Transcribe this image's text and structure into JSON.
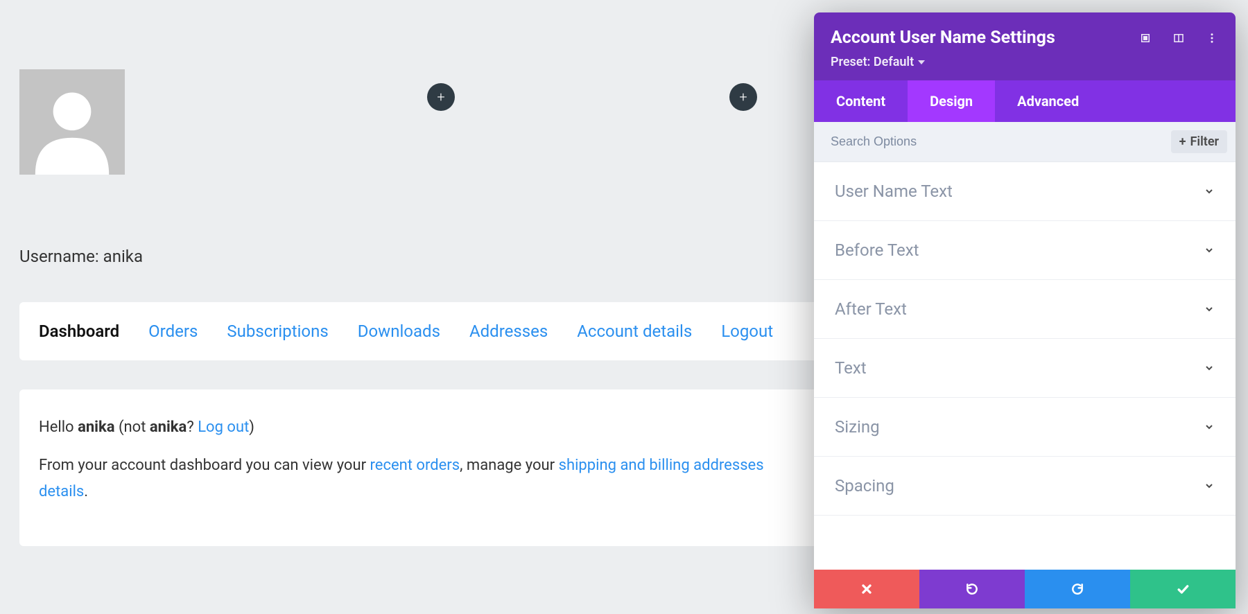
{
  "account": {
    "username_label": "Username:",
    "username": "anika"
  },
  "nav": {
    "items": [
      {
        "label": "Dashboard",
        "active": true
      },
      {
        "label": "Orders"
      },
      {
        "label": "Subscriptions"
      },
      {
        "label": "Downloads"
      },
      {
        "label": "Addresses"
      },
      {
        "label": "Account details"
      },
      {
        "label": "Logout"
      }
    ]
  },
  "dashboard": {
    "greeting_prefix": "Hello ",
    "user_bold": "anika",
    "not_prefix": " (not ",
    "not_user_bold": "anika",
    "question": "? ",
    "logout_link": "Log out",
    "close_paren": ")",
    "line2_a": "From your account dashboard you can view your ",
    "link_orders": "recent orders",
    "line2_b": ", manage your ",
    "link_addresses": "shipping and billing addresses",
    "link_details": "details",
    "period": "."
  },
  "panel": {
    "title": "Account User Name Settings",
    "preset_label": "Preset: Default",
    "tabs": [
      {
        "label": "Content"
      },
      {
        "label": "Design",
        "active": true
      },
      {
        "label": "Advanced"
      }
    ],
    "search_placeholder": "Search Options",
    "filter_label": "Filter",
    "sections": [
      {
        "label": "User Name Text"
      },
      {
        "label": "Before Text"
      },
      {
        "label": "After Text"
      },
      {
        "label": "Text"
      },
      {
        "label": "Sizing"
      },
      {
        "label": "Spacing"
      }
    ]
  }
}
